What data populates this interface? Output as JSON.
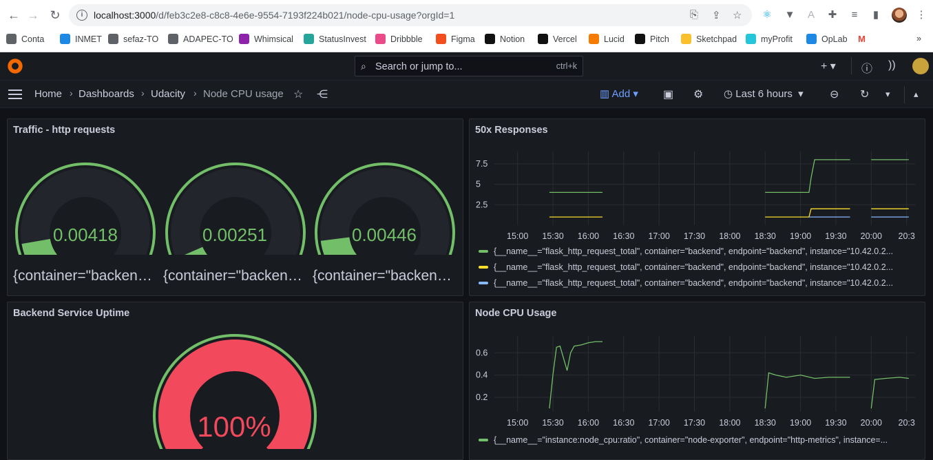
{
  "browser": {
    "url_host": "localhost:3000",
    "url_path": "/d/feb3c2e8-c8c8-4e6e-9554-7193f224b021/node-cpu-usage?orgId=1",
    "bookmarks": [
      {
        "label": "Conta",
        "color": "#5f6368"
      },
      {
        "label": "INMET",
        "color": "#1e88e5"
      },
      {
        "label": "sefaz-TO",
        "color": "#5f6368"
      },
      {
        "label": "ADAPEC-TO",
        "color": "#5f6368"
      },
      {
        "label": "Whimsical",
        "color": "#8e24aa"
      },
      {
        "label": "StatusInvest",
        "color": "#26a69a"
      },
      {
        "label": "Dribbble",
        "color": "#ea4c89"
      },
      {
        "label": "Figma",
        "color": "#f24e1e"
      },
      {
        "label": "Notion",
        "color": "#111111"
      },
      {
        "label": "Vercel",
        "color": "#111111"
      },
      {
        "label": "Lucid",
        "color": "#f57c00"
      },
      {
        "label": "Pitch",
        "color": "#111111"
      },
      {
        "label": "Sketchpad",
        "color": "#fbc02d"
      },
      {
        "label": "myProfit",
        "color": "#26c6da"
      },
      {
        "label": "OpLab",
        "color": "#1e88e5"
      },
      {
        "label": "M",
        "color": "#ea4335"
      }
    ]
  },
  "grafana": {
    "search_placeholder": "Search or jump to...",
    "search_shortcut": "ctrl+k",
    "breadcrumbs": [
      "Home",
      "Dashboards",
      "Udacity",
      "Node CPU usage"
    ],
    "add_label": "Add",
    "time_range": "Last 6 hours"
  },
  "panels": {
    "traffic": {
      "title": "Traffic - http requests",
      "gauges": [
        {
          "value": "0.00418",
          "label": "{container=\"backend\"...",
          "fraction": 0.13
        },
        {
          "value": "0.00251",
          "label": "{container=\"backend\"...",
          "fraction": 0.08
        },
        {
          "value": "0.00446",
          "label": "{container=\"backend\"...",
          "fraction": 0.14
        }
      ]
    },
    "responses": {
      "title": "50x Responses",
      "legend": [
        {
          "text": "{__name__=\"flask_http_request_total\", container=\"backend\", endpoint=\"backend\", instance=\"10.42.0.2...",
          "color": "#73bf69"
        },
        {
          "text": "{__name__=\"flask_http_request_total\", container=\"backend\", endpoint=\"backend\", instance=\"10.42.0.2...",
          "color": "#fade2a"
        },
        {
          "text": "{__name__=\"flask_http_request_total\", container=\"backend\", endpoint=\"backend\", instance=\"10.42.0.2...",
          "color": "#8ab8ff"
        }
      ]
    },
    "uptime": {
      "title": "Backend Service Uptime",
      "value": "100%",
      "fraction": 1.0
    },
    "cpu": {
      "title": "Node CPU Usage",
      "legend": [
        {
          "text": "{__name__=\"instance:node_cpu:ratio\", container=\"node-exporter\", endpoint=\"http-metrics\", instance=...",
          "color": "#73bf69"
        }
      ]
    }
  },
  "chart_data": [
    {
      "type": "line",
      "title": "50x Responses",
      "x_ticks": [
        "15:00",
        "15:30",
        "16:00",
        "16:30",
        "17:00",
        "17:30",
        "18:00",
        "18:30",
        "19:00",
        "19:30",
        "20:00",
        "20:3"
      ],
      "y_ticks": [
        "2.5",
        "5",
        "7.5"
      ],
      "ylim": [
        0,
        9
      ],
      "series": [
        {
          "color": "#73bf69",
          "segments": [
            [
              [
                15.45,
                4
              ],
              [
                16.2,
                4
              ]
            ],
            [
              [
                18.5,
                4
              ],
              [
                19.12,
                4
              ],
              [
                19.15,
                5.8
              ],
              [
                19.2,
                8
              ],
              [
                19.7,
                8
              ]
            ],
            [
              [
                20.0,
                8
              ],
              [
                20.53,
                8
              ]
            ]
          ]
        },
        {
          "color": "#fade2a",
          "segments": [
            [
              [
                15.45,
                1
              ],
              [
                16.2,
                1
              ]
            ],
            [
              [
                18.5,
                1
              ],
              [
                19.12,
                1
              ],
              [
                19.15,
                2
              ],
              [
                19.7,
                2
              ]
            ],
            [
              [
                20.0,
                2
              ],
              [
                20.53,
                2
              ]
            ]
          ]
        },
        {
          "color": "#8ab8ff",
          "segments": [
            [
              [
                19.12,
                1
              ],
              [
                19.7,
                1
              ]
            ],
            [
              [
                20.0,
                1
              ],
              [
                20.53,
                1
              ]
            ]
          ]
        }
      ]
    },
    {
      "type": "line",
      "title": "Node CPU Usage",
      "x_ticks": [
        "15:00",
        "15:30",
        "16:00",
        "16:30",
        "17:00",
        "17:30",
        "18:00",
        "18:30",
        "19:00",
        "19:30",
        "20:00",
        "20:3"
      ],
      "y_ticks": [
        "0.2",
        "0.4",
        "0.6"
      ],
      "ylim": [
        0.07,
        0.75
      ],
      "series": [
        {
          "color": "#73bf69",
          "segments": [
            [
              [
                15.45,
                0.1
              ],
              [
                15.5,
                0.4
              ],
              [
                15.55,
                0.65
              ],
              [
                15.6,
                0.66
              ],
              [
                15.65,
                0.55
              ],
              [
                15.7,
                0.44
              ],
              [
                15.75,
                0.6
              ],
              [
                15.8,
                0.66
              ],
              [
                15.9,
                0.67
              ],
              [
                16.0,
                0.69
              ],
              [
                16.1,
                0.7
              ],
              [
                16.2,
                0.7
              ]
            ],
            [
              [
                18.5,
                0.1
              ],
              [
                18.55,
                0.42
              ],
              [
                18.65,
                0.4
              ],
              [
                18.8,
                0.38
              ],
              [
                19.0,
                0.4
              ],
              [
                19.2,
                0.37
              ],
              [
                19.4,
                0.38
              ],
              [
                19.7,
                0.38
              ]
            ],
            [
              [
                20.0,
                0.1
              ],
              [
                20.05,
                0.36
              ],
              [
                20.2,
                0.37
              ],
              [
                20.4,
                0.38
              ],
              [
                20.53,
                0.37
              ]
            ]
          ]
        }
      ]
    }
  ]
}
